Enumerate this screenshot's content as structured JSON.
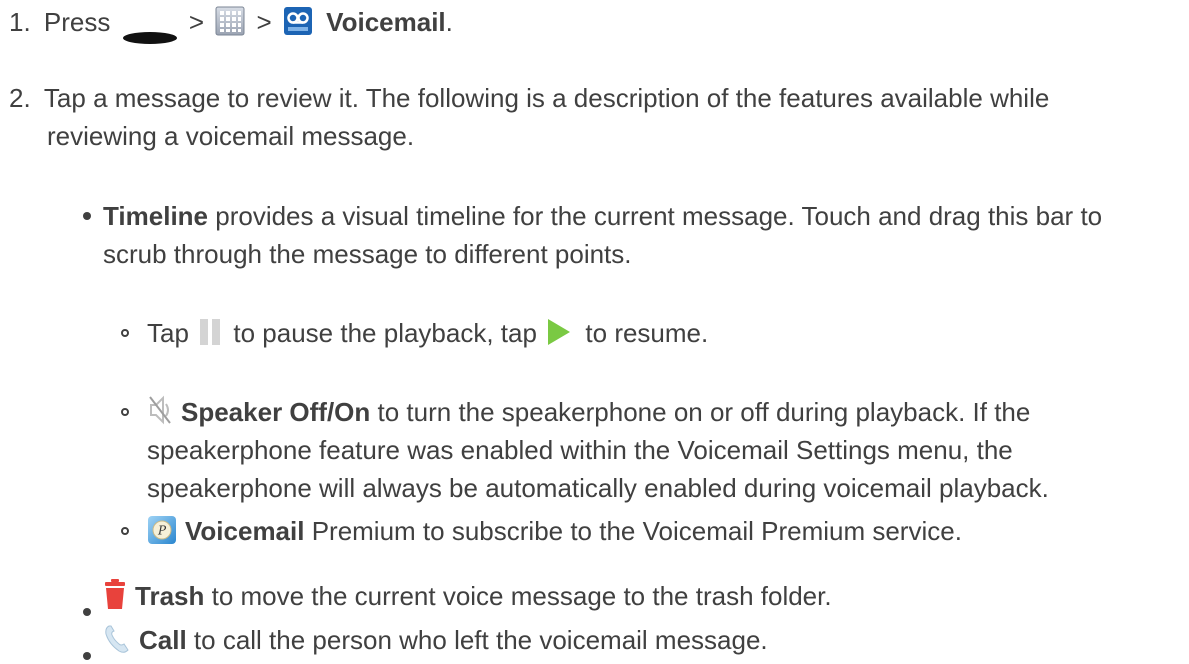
{
  "steps": [
    {
      "num": "1.",
      "press": "Press",
      "sep1": ">",
      "sep2": ">",
      "target": "Voicemail",
      "end": ".",
      "icons": [
        "home-key-icon",
        "apps-grid-icon",
        "voicemail-app-icon"
      ]
    },
    {
      "num": "2.",
      "line1": "Tap a message to review it. The following is a description of the features available while",
      "line2": "reviewing a voicemail message."
    }
  ],
  "features": {
    "timeline": {
      "label": "Timeline",
      "line1": " provides a visual timeline for the current message. Touch and drag this bar to",
      "line2": "scrub through the message to different points."
    },
    "pause": {
      "pre": "Tap",
      "mid": "to pause the playback, tap",
      "post": "to resume.",
      "icons": [
        "pause-icon",
        "play-icon"
      ]
    },
    "speaker": {
      "label": "Speaker Off/On",
      "line1": " to turn the speakerphone on or off during playback. If the",
      "line2": "speakerphone feature was enabled within the Voicemail Settings menu, the",
      "line3": "speakerphone will always be automatically enabled during voicemail playback.",
      "icon": "speaker-off-icon"
    },
    "premium": {
      "label": "Voicemail",
      "rest": " Premium to subscribe to the Voicemail Premium service.",
      "icon": "voicemail-premium-icon"
    },
    "trash": {
      "label": "Trash",
      "rest": " to move the current voice message to the trash folder.",
      "icon": "trash-icon"
    },
    "call": {
      "label": "Call",
      "rest": " to call the person who left the voicemail message.",
      "icon": "call-icon"
    }
  }
}
